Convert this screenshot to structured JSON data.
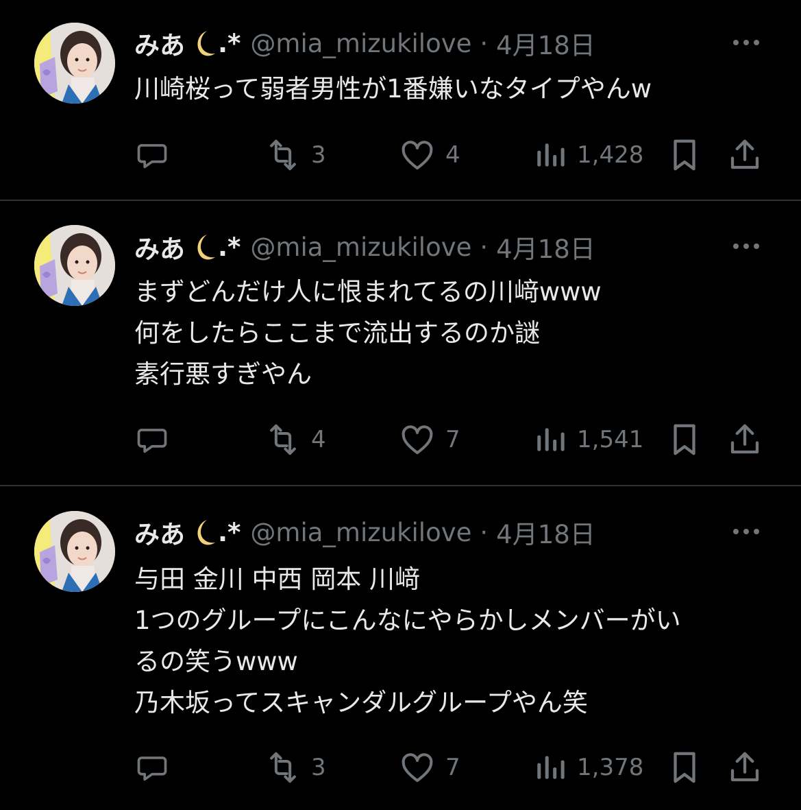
{
  "colors": {
    "background": "#000000",
    "text_primary": "#e7e9ea",
    "text_secondary": "#71767b",
    "divider": "#2f3336",
    "moon": "#f2d07a"
  },
  "tweets": [
    {
      "author": {
        "display_name": "みあ",
        "name_suffix": ".*",
        "emoji_name": "crescent-moon",
        "handle": "@mia_mizukilove",
        "separator": "·",
        "date": "4月18日"
      },
      "lines": [
        "川崎桜って弱者男性が1番嫌いなタイプやんw"
      ],
      "stats": {
        "reply": "",
        "retweet": "3",
        "like": "4",
        "views": "1,428"
      }
    },
    {
      "author": {
        "display_name": "みあ",
        "name_suffix": ".*",
        "emoji_name": "crescent-moon",
        "handle": "@mia_mizukilove",
        "separator": "·",
        "date": "4月18日"
      },
      "lines": [
        "まずどんだけ人に恨まれてるの川﨑www",
        "何をしたらここまで流出するのか謎",
        "素行悪すぎやん"
      ],
      "stats": {
        "reply": "",
        "retweet": "4",
        "like": "7",
        "views": "1,541"
      }
    },
    {
      "author": {
        "display_name": "みあ",
        "name_suffix": ".*",
        "emoji_name": "crescent-moon",
        "handle": "@mia_mizukilove",
        "separator": "·",
        "date": "4月18日"
      },
      "lines": [
        "与田 金川 中西 岡本 川﨑",
        "1つのグループにこんなにやらかしメンバーがい",
        "るの笑うwww",
        "乃木坂ってスキャンダルグループやん笑"
      ],
      "stats": {
        "reply": "",
        "retweet": "3",
        "like": "7",
        "views": "1,378"
      }
    }
  ]
}
